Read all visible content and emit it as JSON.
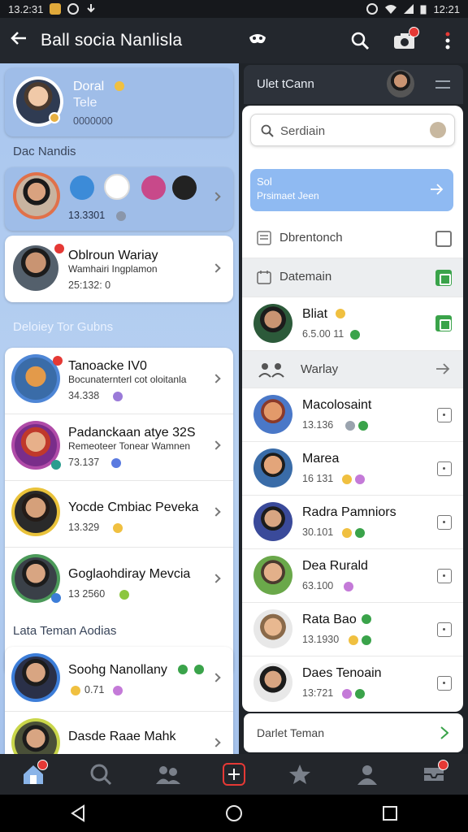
{
  "status_bar": {
    "time_left": "13.2:31",
    "time_right": "12:21"
  },
  "app_bar": {
    "title": "Ball socia Nanlisla"
  },
  "profile": {
    "name": "Doral",
    "subtitle": "Tele",
    "code": "0000000"
  },
  "section1": {
    "title": "Dac Nandis"
  },
  "group_card": {
    "meta": "13.3301"
  },
  "featured": {
    "name": "Oblroun Wariay",
    "sub": "Wamhairi Ingplamon",
    "meta": "25:132: 0"
  },
  "section2": {
    "title": "Deloiey Tor Gubns"
  },
  "list": [
    {
      "name": "Tanoacke IV0",
      "sub": "Bocunaternterl cot oloitanla",
      "meta": "34.338"
    },
    {
      "name": "Padanckaan atye 32S",
      "sub": "Remeoteer Tonear Wamnen",
      "meta": "73.137"
    },
    {
      "name": "Yocde Cmbiac Peveka",
      "sub": "",
      "meta": "13.329"
    },
    {
      "name": "Goglaohdiray Mevcia",
      "sub": "",
      "meta": "13 2560"
    }
  ],
  "section3": {
    "title": "Lata Teman Aodias"
  },
  "bottom_list": [
    {
      "name": "Soohg Nanollany",
      "meta": "0.71"
    },
    {
      "name": "Dasde Raae Mahk",
      "meta": ""
    }
  ],
  "right_panel": {
    "header_title": "Ulet tCann",
    "search_placeholder": "Serdiain",
    "bubble_line1": "Sol",
    "bubble_line2": "Prsimaet Jeen",
    "option1": "Dbrentonch",
    "option2": "Datemain",
    "first_contact": {
      "name": "Bliat",
      "meta": "6.5.00 11"
    },
    "section": "Warlay",
    "contacts": [
      {
        "name": "Macolosaint",
        "meta": "13.136"
      },
      {
        "name": "Marea",
        "meta": "16 131"
      },
      {
        "name": "Radra Pamniors",
        "meta": "30.101"
      },
      {
        "name": "Dea Rurald",
        "meta": "63.100"
      },
      {
        "name": "Rata Bao",
        "meta": "13.1930"
      },
      {
        "name": "Daes Tenoain",
        "meta": "13:721"
      }
    ],
    "footer": "Darlet Teman"
  },
  "colors": {
    "accent": "#8fbaf2",
    "badge": "#e53935",
    "check_green": "#3aa34a"
  }
}
